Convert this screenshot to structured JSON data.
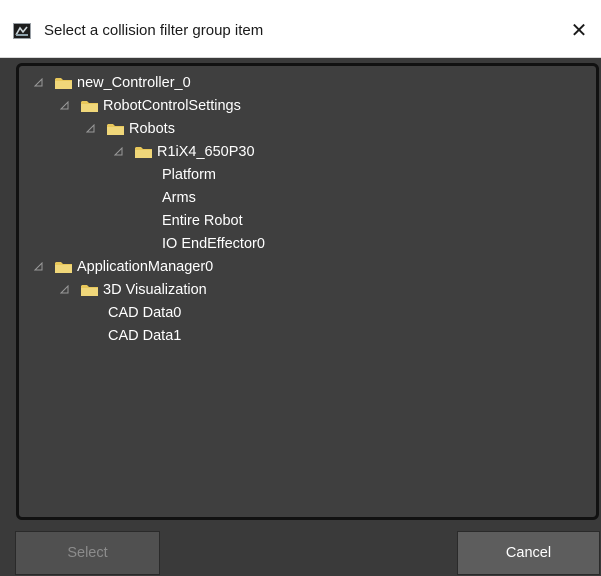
{
  "window": {
    "title": "Select a collision filter group item",
    "close_glyph": "✕",
    "app_icon": "application-icon"
  },
  "tree": {
    "items": [
      {
        "label": "new_Controller_0",
        "icon": "folder-icon",
        "expanded": true
      },
      {
        "label": "RobotControlSettings",
        "icon": "folder-icon",
        "expanded": true
      },
      {
        "label": "Robots",
        "icon": "folder-icon",
        "expanded": true
      },
      {
        "label": "R1iX4_650P30",
        "icon": "folder-icon",
        "expanded": true
      },
      {
        "label": "Platform"
      },
      {
        "label": "Arms"
      },
      {
        "label": "Entire Robot"
      },
      {
        "label": "IO EndEffector0"
      },
      {
        "label": "ApplicationManager0",
        "icon": "folder-icon",
        "expanded": true
      },
      {
        "label": "3D Visualization",
        "icon": "folder-icon",
        "expanded": true
      },
      {
        "label": "CAD Data0"
      },
      {
        "label": "CAD Data1"
      }
    ]
  },
  "buttons": {
    "select_label": "Select",
    "select_enabled": false,
    "cancel_label": "Cancel"
  },
  "colors": {
    "panel_bg": "#3f3f3f",
    "folder_yellow": "#e8c75a",
    "text": "#ffffff"
  }
}
